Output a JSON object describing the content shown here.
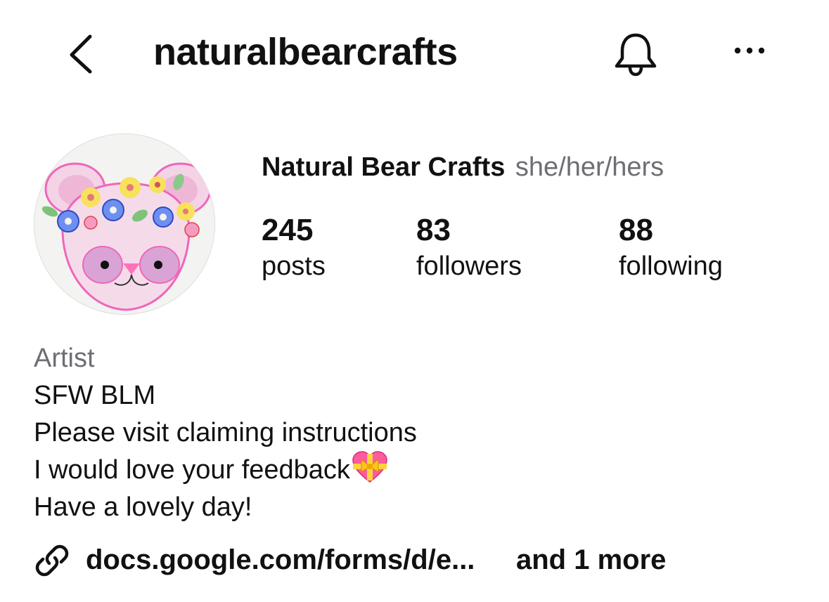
{
  "header": {
    "username": "naturalbearcrafts",
    "back_icon": "chevron-left-icon",
    "notification_icon": "bell-icon",
    "more_icon": "ellipsis-icon"
  },
  "profile": {
    "display_name": "Natural Bear Crafts",
    "pronouns": "she/her/hers",
    "avatar_description_icon": "bear-with-flower-crown-avatar"
  },
  "stats": [
    {
      "count": "245",
      "label": "posts"
    },
    {
      "count": "83",
      "label": "followers"
    },
    {
      "count": "88",
      "label": "following"
    }
  ],
  "bio": {
    "category": "Artist",
    "lines": [
      "SFW BLM",
      "Please visit claiming instructions",
      "I would love your feedback",
      "Have a lovely day!"
    ],
    "emoji_icon": "heart-with-ribbon-emoji"
  },
  "link": {
    "icon": "link-icon",
    "url_text": "docs.google.com/forms/d/e...",
    "more_text": "and 1 more"
  },
  "colors": {
    "text_primary": "#111111",
    "text_secondary": "#6e6e73",
    "background": "#ffffff"
  }
}
